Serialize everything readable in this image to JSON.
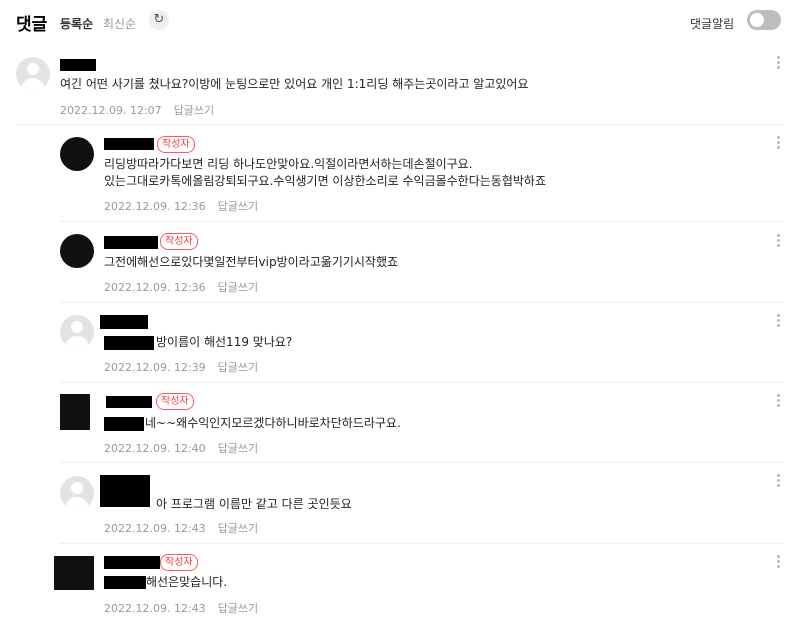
{
  "header": {
    "title": "댓글",
    "sort_registered": "등록순",
    "sort_latest": "최신순",
    "refresh_icon": "refresh-icon",
    "alarm_label": "댓글알림",
    "alarm_on": false
  },
  "comments": [
    {
      "author_badge": "",
      "text": [
        "여긴 어떤 사기를 쳤나요?이방에 눈팅으로만 있어요 개인 1:1리딩 해주는곳이라고 알고있어요"
      ],
      "date": "2022.12.09. 12:07",
      "reply_label": "답글쓰기"
    },
    {
      "author_badge": "작성자",
      "text": [
        "리딩방따라가다보면 리딩 하나도안맞아요.익절이라면서하는데손절이구요.",
        "있는그대로카톡에올림강퇴되구요.수익생기면 이상한소리로 수익금몰수한다는동협박하죠"
      ],
      "date": "2022.12.09. 12:36",
      "reply_label": "답글쓰기"
    },
    {
      "author_badge": "작성자",
      "text": [
        "그전에해선으로있다몇일전부터vip방이라고옮기기시작했죠"
      ],
      "date": "2022.12.09. 12:36",
      "reply_label": "답글쓰기"
    },
    {
      "author_badge": "",
      "text": [
        "방이름이 해선119 맞나요?"
      ],
      "date": "2022.12.09. 12:39",
      "reply_label": "답글쓰기"
    },
    {
      "author_badge": "작성자",
      "text": [
        "네~~왜수익인지모르겠다하니바로차단하드라구요."
      ],
      "date": "2022.12.09. 12:40",
      "reply_label": "답글쓰기"
    },
    {
      "author_badge": "",
      "text": [
        "아 프로그램 이름만 같고 다른 곳인듯요"
      ],
      "date": "2022.12.09. 12:43",
      "reply_label": "답글쓰기"
    },
    {
      "author_badge": "작성자",
      "text": [
        "해선은맞습니다."
      ],
      "date": "2022.12.09. 12:43",
      "reply_label": "답글쓰기"
    }
  ],
  "icons": {
    "more": "more-vertical-icon",
    "avatar_default": "default-avatar-icon"
  }
}
